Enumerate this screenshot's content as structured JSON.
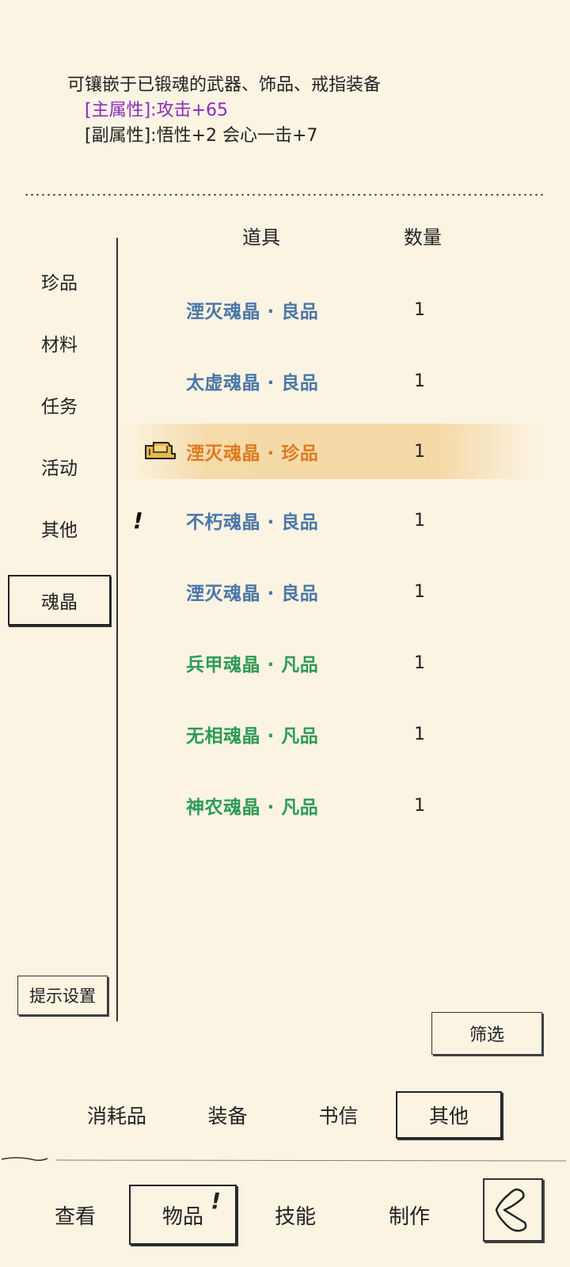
{
  "description": {
    "line1": "可镶嵌于已锻魂的武器、饰品、戒指装备",
    "main_attr": "[主属性]:攻击+65",
    "sub_attr": "[副属性]:悟性+2 会心一击+7"
  },
  "table": {
    "col_item": "道具",
    "col_qty": "数量"
  },
  "sidebar": {
    "items": [
      {
        "label": "珍品"
      },
      {
        "label": "材料"
      },
      {
        "label": "任务"
      },
      {
        "label": "活动"
      },
      {
        "label": "其他"
      },
      {
        "label": "魂晶"
      }
    ],
    "active_index": 5,
    "hint_settings": "提示设置"
  },
  "items": [
    {
      "name": "湮灭魂晶 · 良品",
      "qty": "1",
      "color": "#4a76a8"
    },
    {
      "name": "太虚魂晶 · 良品",
      "qty": "1",
      "color": "#4a76a8"
    },
    {
      "name": "湮灭魂晶 · 珍品",
      "qty": "1",
      "color": "#e07a20",
      "selected": true,
      "icon": "equipped-shoe-icon"
    },
    {
      "name": "不朽魂晶 · 良品",
      "qty": "1",
      "color": "#4a76a8",
      "marker": "!"
    },
    {
      "name": "湮灭魂晶 · 良品",
      "qty": "1",
      "color": "#4a76a8"
    },
    {
      "name": "兵甲魂晶 · 凡品",
      "qty": "1",
      "color": "#2e9a55"
    },
    {
      "name": "无相魂晶 · 凡品",
      "qty": "1",
      "color": "#2e9a55"
    },
    {
      "name": "神农魂晶 · 凡品",
      "qty": "1",
      "color": "#2e9a55"
    }
  ],
  "filter_label": "筛选",
  "subtabs": [
    {
      "label": "消耗品"
    },
    {
      "label": "装备"
    },
    {
      "label": "书信"
    },
    {
      "label": "其他",
      "active": true
    }
  ],
  "navtabs": [
    {
      "label": "查看"
    },
    {
      "label": "物品",
      "active": true,
      "badge": "!"
    },
    {
      "label": "技能"
    },
    {
      "label": "制作"
    }
  ],
  "back_icon": "back-arrow-icon"
}
